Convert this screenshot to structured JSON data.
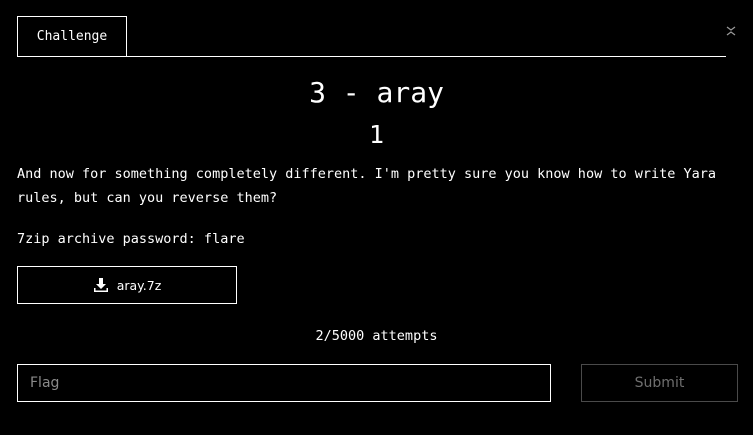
{
  "tab": {
    "label": "Challenge"
  },
  "close_icon": "close-icon",
  "challenge": {
    "name": "3 - aray",
    "points": "1",
    "description": "And now for something completely different. I'm pretty sure you know how to write Yara rules, but can you reverse them?",
    "password_line": "7zip archive password: flare"
  },
  "download": {
    "icon": "download-icon",
    "label": "aray.7z"
  },
  "attempts": "2/5000 attempts",
  "form": {
    "placeholder": "Flag",
    "submit_label": "Submit"
  },
  "colors": {
    "background": "#000000",
    "foreground": "#ffffff",
    "placeholder": "#8a8a8a",
    "disabled_border": "#4a4a4a",
    "disabled_text": "#6f6f6f"
  }
}
